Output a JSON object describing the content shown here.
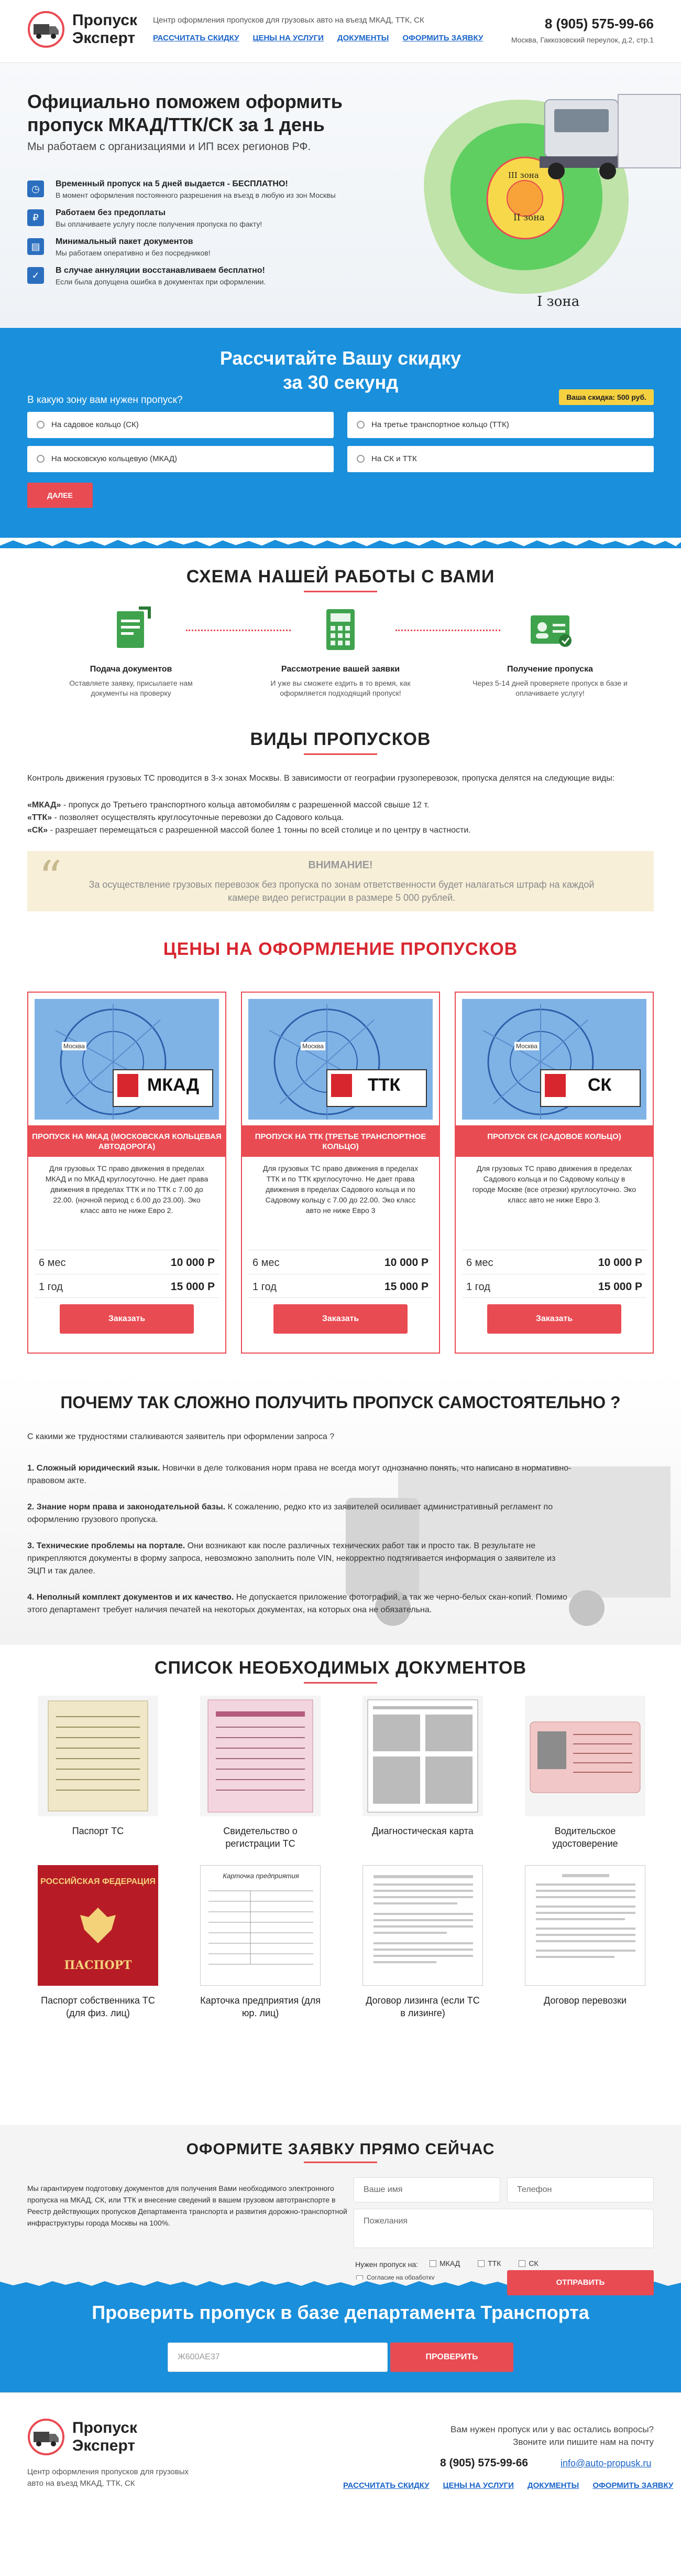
{
  "header": {
    "logo_line1": "Пропуск",
    "logo_line2": "Эксперт",
    "description": "Центр оформления пропусков для грузовых авто на въезд МКАД, ТТК, СК",
    "nav": [
      "РАССЧИТАТЬ СКИДКУ",
      "ЦЕНЫ НА УСЛУГИ",
      "ДОКУМЕНТЫ",
      "ОФОРМИТЬ ЗАЯВКУ"
    ],
    "phone": "8 (905) 575-99-66",
    "address": "Москва, Гаккозовский переулок, д.2, стр.1"
  },
  "hero": {
    "title": "Официально поможем оформить пропуск МКАД/ТТК/СК за 1 день",
    "subtitle": "Мы работаем с организациями и ИП всех регионов РФ.",
    "benefits": [
      {
        "title": "Временный пропуск на 5 дней выдается - БЕСПЛАТНО!",
        "desc": "В момент оформления постоянного разрешения на въезд в любую из зон Москвы"
      },
      {
        "title": "Работаем без предоплаты",
        "desc": "Вы оплачиваете услугу после получения пропуска по факту!"
      },
      {
        "title": "Минимальный пакет документов",
        "desc": "Мы работаем оперативно и без посредников!"
      },
      {
        "title": "В случае аннуляции восстанавливаем бесплатно!",
        "desc": "Если была допущена ошибка в документах при оформлении."
      }
    ],
    "zone_labels": [
      "III зона",
      "II зона",
      "I зона"
    ]
  },
  "calc": {
    "title_line1": "Рассчитайте Вашу скидку",
    "title_line2": "за 30 секунд",
    "question": "В какую зону вам нужен пропуск?",
    "badge": "Ваша скидка: 500 руб.",
    "options": [
      "На садовое кольцо (СК)",
      "На третье транспортное кольцо (ТТК)",
      "На московскую кольцевую (МКАД)",
      "На СК и ТТК"
    ],
    "button": "ДАЛЕЕ"
  },
  "scheme": {
    "title": "СХЕМА НАШЕЙ РАБОТЫ С ВАМИ",
    "steps": [
      {
        "title": "Подача документов",
        "desc": "Оставляете заявку, присылаете нам документы на проверку"
      },
      {
        "title": "Рассмотрение вашей заявки",
        "desc": "И уже вы сможете ездить в то время, как оформляется подходящий пропуск!"
      },
      {
        "title": "Получение пропуска",
        "desc": "Через 5-14 дней проверяете пропуск в базе и оплачиваете услугу!"
      }
    ]
  },
  "types": {
    "title": "ВИДЫ ПРОПУСКОВ",
    "intro": "Контроль движения грузовых ТС проводится в 3-х зонах Москвы. В зависимости от географии грузоперевозок, пропуска делятся на следующие виды:",
    "items": [
      {
        "key": "«МКАД»",
        "text": " - пропуск до Третьего транспортного кольца автомобилям с разрешенной массой свыше 12 т."
      },
      {
        "key": "«ТТК»",
        "text": " - позволяет осуществлять круглосуточные перевозки до Садового кольца."
      },
      {
        "key": "«СК»",
        "text": " - разрешает перемещаться с разрешенной массой более 1 тонны по всей столице и по центру в частности."
      }
    ],
    "attention_title": "ВНИМАНИЕ!",
    "attention_text": "За осуществление грузовых перевозок без пропуска по зонам ответственности будет налагаться штраф на каждой камере видео регистрации в размере 5 000 рублей."
  },
  "prices": {
    "title": "ЦЕНЫ НА ОФОРМЛЕНИЕ ПРОПУСКОВ",
    "cards": [
      {
        "zone": "МКАД",
        "title": "ПРОПУСК НА МКАД (МОСКОВСКАЯ КОЛЬЦЕВАЯ АВТОДОРОГА)",
        "desc": "Для грузовых ТС право движения в пределах МКАД и по МКАД круглосуточно. Не дает права движения в пределах ТТК и по ТТК с 7.00 до 22.00. (ночной период с 6.00 до 23.00). Эко класс авто не ниже Евро 2.",
        "p1_label": "6 мес",
        "p1": "10 000 Р",
        "p2_label": "1 год",
        "p2": "15 000 Р",
        "button": "Заказать"
      },
      {
        "zone": "ТТК",
        "title": "ПРОПУСК НА ТТК (ТРЕТЬЕ ТРАНСПОРТНОЕ КОЛЬЦО)",
        "desc": "Для грузовых ТС право движения в пределах ТТК и по ТТК круглосуточно. Не дает права движения в пределах Садового кольца и по Садовому кольцу с 7.00 до 22.00. Эко класс авто не ниже Евро 3",
        "p1_label": "6 мес",
        "p1": "10 000 Р",
        "p2_label": "1 год",
        "p2": "15 000 Р",
        "button": "Заказать"
      },
      {
        "zone": "СК",
        "title": "ПРОПУСК СК (САДОВОЕ КОЛЬЦО)",
        "desc": "Для грузовых ТС право движения в пределах Садового кольца и по Садовому кольцу в городе Москве (все отрезки) круглосуточно. Эко класс авто не ниже Евро 3.",
        "p1_label": "6 мес",
        "p1": "10 000 Р",
        "p2_label": "1 год",
        "p2": "15 000 Р",
        "button": "Заказать"
      }
    ],
    "map_label": "Москва"
  },
  "why": {
    "title": "ПОЧЕМУ ТАК СЛОЖНО ПОЛУЧИТЬ ПРОПУСК САМОСТОЯТЕЛЬНО ?",
    "intro": "С какими же трудностями сталкиваются заявитель при оформлении запроса ?",
    "points": [
      {
        "b": "1. Сложный юридический язык.",
        "t": " Новички в деле толкования норм права не всегда могут однозначно понять, что написано в нормативно-правовом акте."
      },
      {
        "b": "2. Знание норм права и законодательной базы.",
        "t": " К сожалению, редко кто из заявителей осиливает административный регламент по оформлению грузового пропуска."
      },
      {
        "b": "3. Технические проблемы на портале.",
        "t": " Они возникают как после различных технических работ так и просто так. В результате не прикрепляются документы в форму запроса, невозможно заполнить поле VIN, некорректно подтягивается информация о заявителе из ЭЦП и так далее."
      },
      {
        "b": "4. Неполный комплект документов и их качество.",
        "t": " Не допускается приложение фотографий, а так же черно-белых скан-копий. Помимо этого департамент требует наличия печатей на некоторых документах, на которых она не обязательна."
      }
    ]
  },
  "docs": {
    "title": "СПИСОК НЕОБХОДИМЫХ ДОКУМЕНТОВ",
    "items": [
      "Паспорт ТС",
      "Свидетельство о регистрации ТС",
      "Диагностическая карта",
      "Водительское удостоверение",
      "Паспорт собственника ТС (для физ. лиц)",
      "Карточка предприятия (для юр. лиц)",
      "Договор лизинга (если ТС в лизинге)",
      "Договор перевозки"
    ],
    "passport_text": "ПАСПОРТ",
    "passport_top": "РОССИЙСКАЯ ФЕДЕРАЦИЯ",
    "card_title": "Карточка предприятия"
  },
  "order": {
    "title": "ОФОРМИТЕ ЗАЯВКУ ПРЯМО СЕЙЧАС",
    "text": "Мы гарантируем подготовку документов для получения Вами необходимого электронного пропуска на МКАД, СК, или ТТК и внесение сведений в вашем грузовом автотранспорте в Реестр действующих пропусков Департамента транспорта и развития дорожно-транспортной инфраструктуры города Москвы на 100%.",
    "name_placeholder": "Ваше имя",
    "phone_placeholder": "Телефон",
    "wishes_placeholder": "Пожелания",
    "pass_label": "Нужен пропуск на:",
    "pass_options": [
      "МКАД",
      "ТТК",
      "СК"
    ],
    "consent": "Согласие на обработку персональных данных",
    "submit": "ОТПРАВИТЬ"
  },
  "check": {
    "title": "Проверить пропуск в базе департамента Транспорта",
    "input_value": "Ж600АЕ37",
    "button": "ПРОВЕРИТЬ"
  },
  "footer": {
    "logo_line1": "Пропуск",
    "logo_line2": "Эксперт",
    "description": "Центр оформления пропусков для грузовых авто на въезд МКАД, ТТК, СК",
    "question": "Вам нужен пропуск или у вас остались вопросы? Звоните или пишите нам на почту",
    "phone": "8 (905) 575-99-66",
    "email": "info@auto-propusk.ru",
    "nav": [
      "РАССЧИТАТЬ СКИДКУ",
      "ЦЕНЫ НА УСЛУГИ",
      "ДОКУМЕНТЫ",
      "ОФОРМИТЬ ЗАЯВКУ"
    ]
  },
  "colors": {
    "accent_red": "#e94b53",
    "accent_blue": "#1a8fdb",
    "link": "#1a64c8"
  }
}
